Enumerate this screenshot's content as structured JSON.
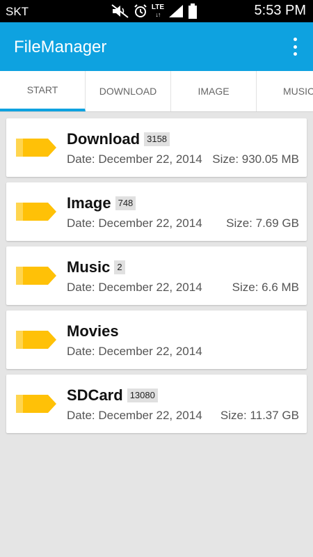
{
  "status_bar": {
    "carrier": "SKT",
    "network": "LTE",
    "time": "5:53 PM"
  },
  "app_bar": {
    "title": "FileManager"
  },
  "tabs": [
    {
      "label": "START",
      "active": true
    },
    {
      "label": "DOWNLOAD",
      "active": false
    },
    {
      "label": "IMAGE",
      "active": false
    },
    {
      "label": "MUSIC",
      "active": false
    }
  ],
  "folders": [
    {
      "name": "Download",
      "count": "3158",
      "date": "Date: December 22, 2014",
      "size": "Size: 930.05 MB"
    },
    {
      "name": "Image",
      "count": "748",
      "date": "Date: December 22, 2014",
      "size": "Size: 7.69 GB"
    },
    {
      "name": "Music",
      "count": "2",
      "date": "Date: December 22, 2014",
      "size": "Size: 6.6 MB"
    },
    {
      "name": "Movies",
      "count": "",
      "date": "Date: December 22, 2014",
      "size": ""
    },
    {
      "name": "SDCard",
      "count": "13080",
      "date": "Date: December 22, 2014",
      "size": "Size: 11.37 GB"
    }
  ],
  "colors": {
    "accent": "#0ea2e0",
    "folder": "#ffc107",
    "folder_shade": "#ffd54f"
  }
}
